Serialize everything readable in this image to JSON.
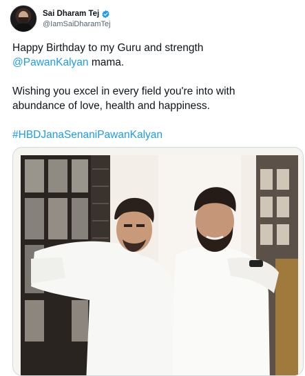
{
  "tweet": {
    "display_name": "Sai Dharam Tej",
    "handle": "@IamSaiDharamTej",
    "line1": "Happy Birthday to my Guru and strength",
    "mention": "@PawanKalyan",
    "line2_after_mention": " mama.",
    "line3": "Wishing you excel in every field you're into with",
    "line4": "abundance of love, health and happiness.",
    "hashtag": "#HBDJanaSenaniPawanKalyan"
  },
  "icons": {
    "verified": "verified-badge-icon"
  },
  "colors": {
    "link": "#1d9bf0",
    "text": "#0f1419",
    "secondary": "#536471",
    "card_border": "#cfd9de"
  }
}
